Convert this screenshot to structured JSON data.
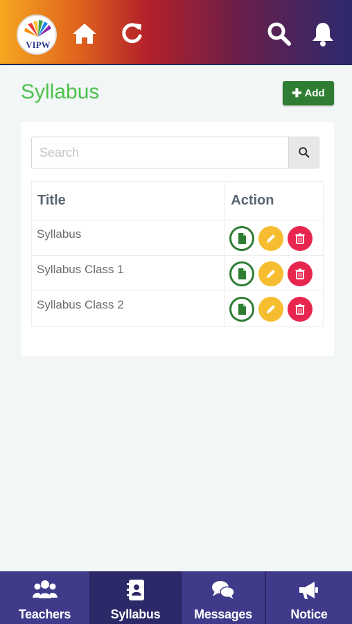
{
  "header": {
    "logo_text": "VIPW",
    "icons": [
      "home-icon",
      "refresh-icon",
      "search-icon",
      "bell-icon"
    ]
  },
  "page": {
    "title": "Syllabus",
    "add_label": "Add"
  },
  "search": {
    "placeholder": "Search",
    "value": ""
  },
  "table": {
    "columns": [
      "Title",
      "Action"
    ],
    "rows": [
      {
        "title": "Syllabus"
      },
      {
        "title": "Syllabus Class 1"
      },
      {
        "title": "Syllabus Class 2"
      }
    ]
  },
  "bottom_nav": [
    {
      "label": "Teachers",
      "icon": "users-icon",
      "active": false
    },
    {
      "label": "Syllabus",
      "icon": "contact-book-icon",
      "active": true
    },
    {
      "label": "Messages",
      "icon": "chat-icon",
      "active": false
    },
    {
      "label": "Notice",
      "icon": "megaphone-icon",
      "active": false
    }
  ],
  "colors": {
    "title_green": "#4cc24c",
    "add_button": "#2e7d32",
    "view": "#2e7d32",
    "edit": "#f7bd31",
    "delete": "#e8254f",
    "bottom_bar": "#3f3a8a"
  }
}
